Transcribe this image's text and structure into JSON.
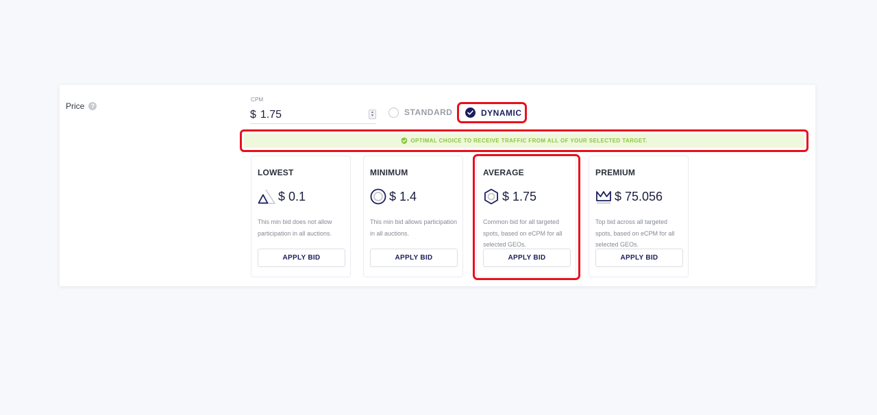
{
  "price": {
    "label": "Price",
    "help_icon": "question-circle-icon"
  },
  "cpm": {
    "caption": "CPM",
    "currency": "$",
    "value": "1.75"
  },
  "pricing_mode": {
    "standard_label": "STANDARD",
    "dynamic_label": "DYNAMIC",
    "selected": "DYNAMIC"
  },
  "banner": {
    "text": "OPTIMAL CHOICE TO RECEIVE TRAFFIC FROM ALL OF YOUR SELECTED TARGET.",
    "icon": "check-shield-icon"
  },
  "cards": [
    {
      "title": "LOWEST",
      "price": "$ 0.1",
      "icon": "triangle-icon",
      "description": "This min bid does not allow participation in all auctions.",
      "button": "APPLY BID"
    },
    {
      "title": "MINIMUM",
      "price": "$ 1.4",
      "icon": "circle-icon",
      "description": "This min bid allows participation in all auctions.",
      "button": "APPLY BID"
    },
    {
      "title": "AVERAGE",
      "price": "$ 1.75",
      "icon": "hexagon-icon",
      "description": "Common bid for all targeted spots, based on eCPM for all selected GEOs.",
      "button": "APPLY BID"
    },
    {
      "title": "PREMIUM",
      "price": "$ 75.056",
      "icon": "crown-icon",
      "description": "Top bid across all targeted spots, based on eCPM for all selected GEOs.",
      "button": "APPLY BID"
    }
  ],
  "colors": {
    "accent": "#1b1e5c",
    "highlight": "#e8101c",
    "banner_bg": "#eff8dc",
    "banner_text": "#8cc63f"
  }
}
